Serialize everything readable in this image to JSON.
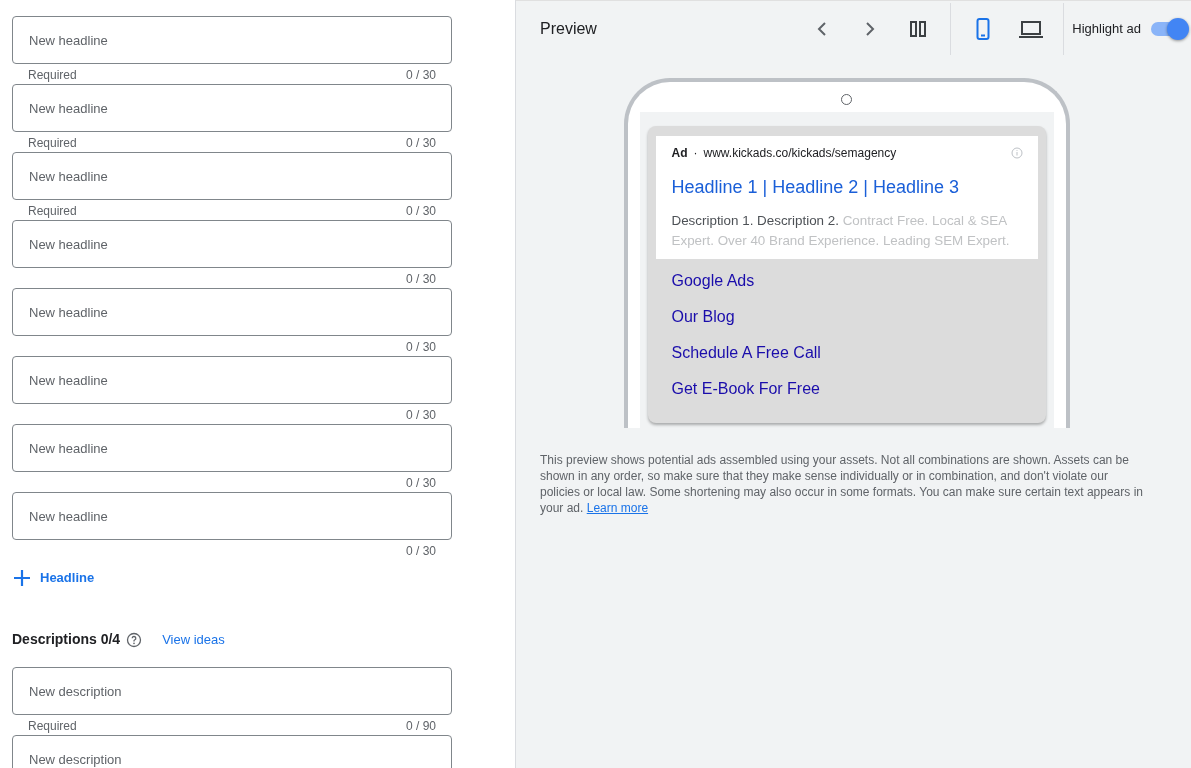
{
  "headlines": [
    {
      "placeholder": "New headline",
      "helper": "Required",
      "counter": "0 / 30"
    },
    {
      "placeholder": "New headline",
      "helper": "Required",
      "counter": "0 / 30"
    },
    {
      "placeholder": "New headline",
      "helper": "Required",
      "counter": "0 / 30"
    },
    {
      "placeholder": "New headline",
      "counter": "0 / 30"
    },
    {
      "placeholder": "New headline",
      "counter": "0 / 30"
    },
    {
      "placeholder": "New headline",
      "counter": "0 / 30"
    },
    {
      "placeholder": "New headline",
      "counter": "0 / 30"
    },
    {
      "placeholder": "New headline",
      "counter": "0 / 30"
    }
  ],
  "add_headline": "Headline",
  "descriptions_section": {
    "title": "Descriptions 0/4",
    "link": "View ideas"
  },
  "descriptions": [
    {
      "placeholder": "New description",
      "helper": "Required",
      "counter": "0 / 90"
    },
    {
      "placeholder": "New description"
    }
  ],
  "preview": {
    "title": "Preview",
    "device_buttons": [
      {
        "kind": "mobile",
        "selected": true
      },
      {
        "kind": "desktop",
        "selected": false
      }
    ],
    "highlight_toggle": {
      "label": "Highlight ad",
      "on": true
    },
    "ad": {
      "badge": "Ad",
      "separator": "·",
      "url": "www.kickads.co/kickads/semagency",
      "headline": "Headline 1 | Headline 2 | Headline 3",
      "description_parts": [
        {
          "text": "Description 1. Description 2.",
          "faded": false
        },
        {
          "text": "Contract Free. Local & SEA Expert. Over 40 Brand Experience. Leading SEM Expert.",
          "faded": true
        }
      ],
      "sitelinks": [
        "Google Ads",
        "Our Blog",
        "Schedule A Free Call",
        "Get E-Book For Free"
      ]
    },
    "note": "This preview shows potential ads assembled using your assets. Not all combinations are shown. Assets can be shown in any order, so make sure that they make sense individually or in combination, and don't violate our policies or local law. Some shortening may also occur in some formats. You can make sure certain text appears in your ad.",
    "note_link": "Learn more"
  }
}
